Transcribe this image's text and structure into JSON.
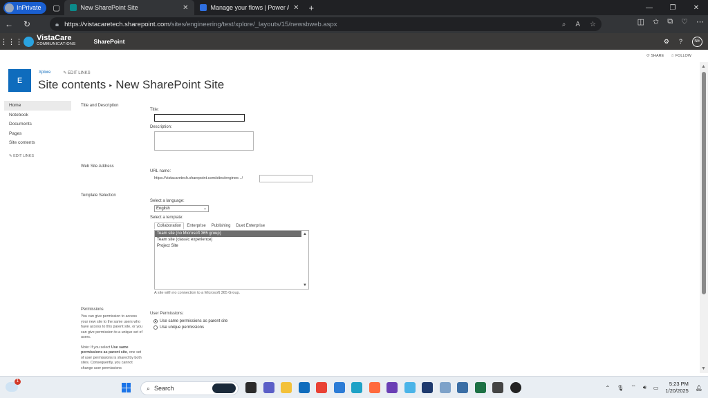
{
  "browser": {
    "inprivate_label": "InPrivate",
    "tabs": [
      {
        "title": "New SharePoint Site",
        "active": true
      },
      {
        "title": "Manage your flows | Power Autom",
        "active": false
      }
    ],
    "url_host": "https://vistacaretech.sharepoint.com",
    "url_path": "/sites/engineering/test/xplore/_layouts/15/newsbweb.aspx"
  },
  "suite": {
    "brand": "VistaCare",
    "brand_sub": "COMMUNICATIONS",
    "app_name": "SharePoint",
    "user_initials": "NE"
  },
  "actions": {
    "share": "SHARE",
    "follow": "FOLLOW"
  },
  "site": {
    "tile_letter": "E",
    "breadcrumb_link": "Xplore",
    "edit_links": "EDIT LINKS",
    "title_part1": "Site contents",
    "title_sep": "▸",
    "title_part2": "New SharePoint Site"
  },
  "leftnav": {
    "items": [
      "Home",
      "Notebook",
      "Documents",
      "Pages",
      "Site contents"
    ],
    "edit_links": "EDIT LINKS"
  },
  "form": {
    "title_desc_section": "Title and Description",
    "title_label": "Title:",
    "title_value": "",
    "description_label": "Description:",
    "web_address_section": "Web Site Address",
    "url_name_label": "URL name:",
    "url_prefix": "https://vistacaretech.sharepoint.com/sites/enginee.../",
    "template_section": "Template Selection",
    "language_label": "Select a language:",
    "language_value": "English",
    "template_label": "Select a template:",
    "template_tabs": [
      "Collaboration",
      "Enterprise",
      "Publishing",
      "Duet Enterprise"
    ],
    "templates": [
      "Team site (no Microsoft 365 group)",
      "Team site (classic experience)",
      "Project Site"
    ],
    "template_description": "A site with no connection to a Microsoft 365 Group.",
    "permissions_section": "Permissions",
    "permissions_desc": "You can give permission to access your new site to the same users who have access to this parent site, or you can give permission to a unique set of users.",
    "permissions_note_prefix": "Note: If you select ",
    "permissions_note_bold": "Use same permissions as parent site",
    "permissions_note_rest": ", one set of user permissions is shared by both sites. Consequently, you cannot change user permissions",
    "user_permissions_label": "User Permissions:",
    "perm_options": [
      "Use same permissions as parent site",
      "Use unique permissions"
    ]
  },
  "taskbar": {
    "weather_badge": "1",
    "search_label": "Search",
    "time": "5:23 PM",
    "date": "1/20/2025"
  }
}
